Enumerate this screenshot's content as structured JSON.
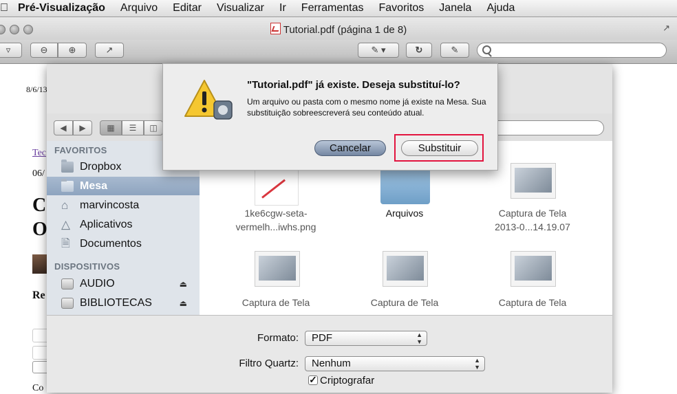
{
  "menubar": {
    "items": [
      "Pré-Visualização",
      "Arquivo",
      "Editar",
      "Visualizar",
      "Ir",
      "Ferramentas",
      "Favoritos",
      "Janela",
      "Ajuda"
    ]
  },
  "window": {
    "title": "Tutorial.pdf (página 1 de 8)"
  },
  "document": {
    "date": "8/6/13",
    "link_text": "Tec",
    "date2": "06/",
    "heading_line1": "C",
    "heading_line2": "O",
    "subheading": "Re",
    "body_fragment": "Co"
  },
  "sheet": {
    "sidebar": {
      "favorites_header": "FAVORITOS",
      "favorites": [
        {
          "label": "Dropbox",
          "icon": "folder-icon"
        },
        {
          "label": "Mesa",
          "icon": "desktop-folder-icon",
          "selected": true
        },
        {
          "label": "marvincosta",
          "icon": "home-icon"
        },
        {
          "label": "Aplicativos",
          "icon": "applications-icon"
        },
        {
          "label": "Documentos",
          "icon": "documents-folder-icon"
        }
      ],
      "devices_header": "DISPOSITIVOS",
      "devices": [
        {
          "label": "AUDIO",
          "icon": "drive-icon"
        },
        {
          "label": "BIBLIOTECAS",
          "icon": "drive-icon"
        }
      ]
    },
    "files": [
      {
        "label_line1": "1ke6cgw-seta-",
        "label_line2": "vermelh...iwhs.png"
      },
      {
        "label_line1": "Arquivos",
        "label_line2": ""
      },
      {
        "label_line1": "Captura de Tela",
        "label_line2": "2013-0...14.19.07"
      },
      {
        "label_line1": "Captura de Tela",
        "label_line2": ""
      },
      {
        "label_line1": "Captura de Tela",
        "label_line2": ""
      },
      {
        "label_line1": "Captura de Tela",
        "label_line2": ""
      }
    ],
    "format_label": "Formato:",
    "format_value": "PDF",
    "quartz_label": "Filtro Quartz:",
    "quartz_value": "Nenhum",
    "encrypt_label": "Criptografar",
    "encrypt_checked": true
  },
  "alert": {
    "title": "\"Tutorial.pdf\" já existe. Deseja substituí-lo?",
    "message": "Um arquivo ou pasta com o mesmo nome já existe na Mesa. Sua substituição sobreescreverá seu conteúdo atual.",
    "cancel_label": "Cancelar",
    "replace_label": "Substituir",
    "highlight_color": "#e2133e"
  }
}
